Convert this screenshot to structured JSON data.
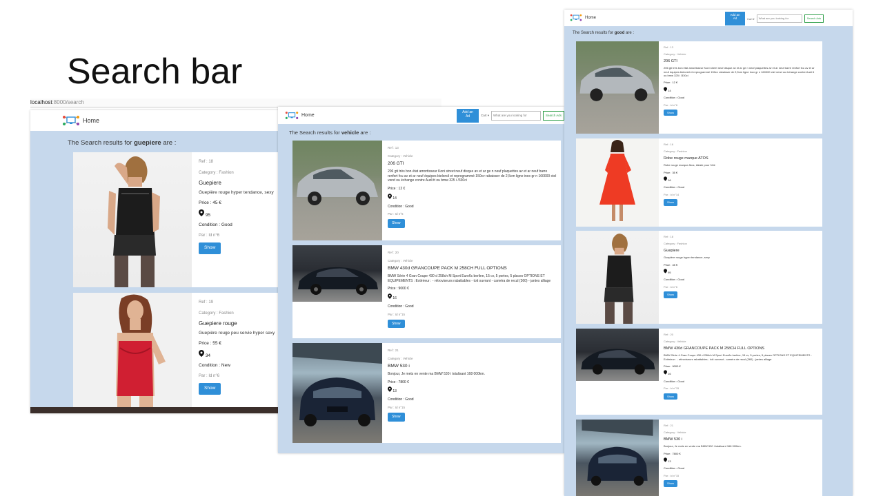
{
  "slide": {
    "title": "Search bar"
  },
  "browser": {
    "url_host": "localhost",
    "url_path": ":8000/search"
  },
  "nav": {
    "home_label": "Home",
    "add_ad_line1": "Add an",
    "add_ad_line2": "Ad",
    "cart_label": "Cart ▾",
    "search_placeholder": "What are you looking for",
    "search_button": "Search Ads"
  },
  "shot1": {
    "heading_prefix": "The Search results for ",
    "query": "guepiere",
    "heading_suffix": " are :",
    "cards": [
      {
        "ref": "Ref : 18",
        "category": "Category : Fashion",
        "title": "Guepiere",
        "desc": "Guepière rouge hyper tendance, sexy",
        "price": "Price : 45 €",
        "location": "95",
        "condition": "Condition : Good",
        "seller": "Par : Id n°6",
        "button": "Show"
      },
      {
        "ref": "Ref : 19",
        "category": "Category : Fashion",
        "title": "Guepiere rouge",
        "desc": "Guepière rouge peu servie hyper sexy",
        "price": "Price : 55 €",
        "location": "34",
        "condition": "Condition : New",
        "seller": "Par : Id n°6",
        "button": "Show"
      }
    ]
  },
  "shot2": {
    "heading_prefix": "The Search results for ",
    "query": "vehicle",
    "heading_suffix": " are :",
    "cards": [
      {
        "ref": "Ref : 13",
        "category": "Category : Vehicle",
        "title": "206 GTI",
        "desc": "206 gti très bon état amortisseur Koni street neuf disque av et ar ge n neuf plaquettes av et ar neuf barre renfort fcu av et ar neuf équipes bielorsil et reprogrammé 150cv rabaisser de 2,5cm ligne inox gr n 160000 ctel vend ou échange contre Audi tt ou bmw 325 i /330ci",
        "price": "Price : 12 €",
        "location": "14",
        "condition": "Condition : Good",
        "seller": "Par : Id n°6",
        "button": "Show"
      },
      {
        "ref": "Ref : 20",
        "category": "Category : Vehicle",
        "title": "BMW 430d GRANCOUPE PACK M 258CH FULL OPTIONS",
        "desc": "BMW Série 4 Gran Coupe 430 d 258ch M Sport Euro6c berline, 15 cv, 5 portes, 5 places OPTIONS ET EQUIPEMENTS : Extérieur : - rétroviseurs rabattables - toit ouvrant - caméra de recul (360) - jantes alliage",
        "price": "Price : 9000 €",
        "location": "16",
        "condition": "Condition : Good",
        "seller": "Par : Id n°15",
        "button": "Show"
      },
      {
        "ref": "Ref : 21",
        "category": "Category : Vehicle",
        "title": "BMW 530 i",
        "desc": "Bonjour, Je mets en vente ma BMW 530 i totalisant 168 000km.",
        "price": "Price : 7800 €",
        "location": "13",
        "condition": "Condition : Good",
        "seller": "Par : Id n°15",
        "button": "Show"
      }
    ]
  },
  "shot3": {
    "heading_prefix": "The Search results for ",
    "query": "good",
    "heading_suffix": " are :",
    "cards": [
      {
        "ref": "Ref : 13",
        "category": "Category : Vehicle",
        "title": "206 GTI",
        "desc": "206 gti très bon état amortisseur Koni street neuf disque av et ar ge n neuf plaquettes av et ar neuf barre renfort fcu av et ar neuf équipes bielorsil et reprogrammé 150cv rabaisser de 2,5cm ligne inox gr n 160000 ctel vend ou échange contre Audi tt ou bmw 325 i /330ci",
        "price": "Price : 12 €",
        "location": "14",
        "condition": "Condition : Good",
        "seller": "Par : Id n°6",
        "button": "Show"
      },
      {
        "ref": "Ref : 16",
        "category": "Category : Fashion",
        "title": "Robe rouge marque ATOS",
        "desc": "Robe rouge marque Atos, idéale pour l'été",
        "price": "Price : 35 €",
        "location": "16",
        "condition": "Condition : Good",
        "seller": "Par : Id n°14",
        "button": "Show"
      },
      {
        "ref": "Ref : 18",
        "category": "Category : Fashion",
        "title": "Guepiere",
        "desc": "Guepière rouge hyper tendance, sexy",
        "price": "Price : 45 €",
        "location": "95",
        "condition": "Condition : Good",
        "seller": "Par : Id n°6",
        "button": "Show"
      },
      {
        "ref": "Ref : 20",
        "category": "Category : Vehicle",
        "title": "BMW 430d GRANCOUPE PACK M 258CH FULL OPTIONS",
        "desc": "BMW Série 4 Gran Coupe 430 d 258ch M Sport Euro6c berline, 15 cv, 5 portes, 5 places OPTIONS ET EQUIPEMENTS : Extérieur : - rétroviseurs rabattables - toit ouvrant - caméra de recul (360) - jantes alliage",
        "price": "Price : 9000 €",
        "location": "16",
        "condition": "Condition : Good",
        "seller": "Par : Id n°15",
        "button": "Show"
      },
      {
        "ref": "Ref : 21",
        "category": "Category : Vehicle",
        "title": "BMW 530 i",
        "desc": "Bonjour, Je mets en vente ma BMW 530 i totalisant 168 000km.",
        "price": "Price : 7800 €",
        "location": "13",
        "condition": "Condition : Good",
        "seller": "Par : Id n°15",
        "button": "Show"
      }
    ]
  },
  "colors": {
    "page_bg": "#c6d8ec",
    "button_blue": "#2f8fd8",
    "search_green": "#2a9d45"
  }
}
